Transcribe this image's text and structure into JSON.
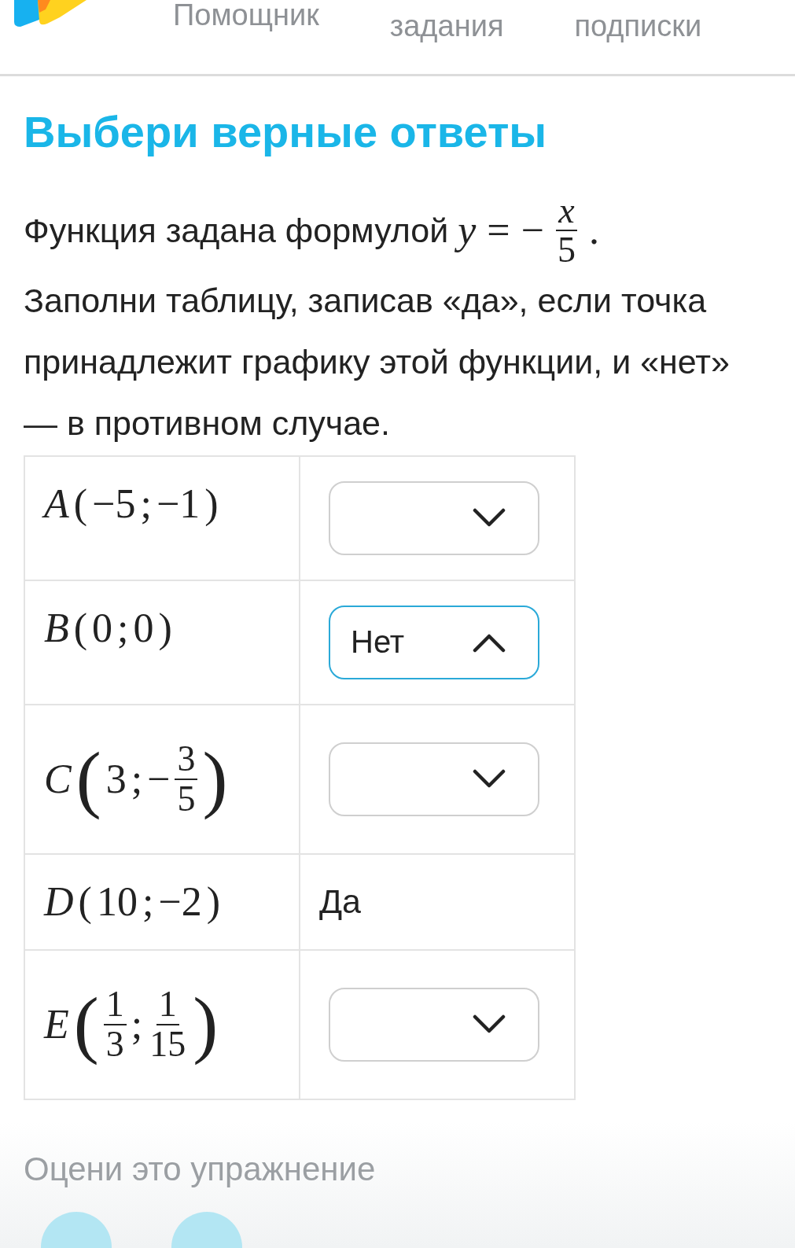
{
  "header": {
    "nav": [
      {
        "label": "Помощник",
        "selected": false
      },
      {
        "label": "задания",
        "selected": false
      },
      {
        "label": "подписки",
        "selected": false
      }
    ]
  },
  "title": "Выбери верные ответы",
  "statement": {
    "text": "Функция задана формулой",
    "formula": {
      "lhs": "y",
      "sign": "=",
      "minus": "−",
      "numerator": "x",
      "denominator": "5",
      "end": "."
    }
  },
  "instruction": "Заполни таблицу, записав «да», если точка принадлежит графику этой функции, и «нет» — в противном случае.",
  "rows": [
    {
      "point": "A",
      "open": "(",
      "sep": ";",
      "close": ")",
      "coords": [
        {
          "kind": "plain",
          "text": "−5"
        },
        {
          "kind": "plain",
          "text": "−1"
        }
      ],
      "answer": {
        "kind": "dropdown",
        "expanded": false
      }
    },
    {
      "point": "B",
      "open": "(",
      "sep": ";",
      "close": ")",
      "coords": [
        {
          "kind": "plain",
          "text": "0"
        },
        {
          "kind": "plain",
          "text": "0"
        }
      ],
      "answer": {
        "kind": "dropdown",
        "value": "Нет",
        "expanded": true
      }
    },
    {
      "point": "C",
      "open": "(",
      "sep": ";",
      "close": ")",
      "coords": [
        {
          "kind": "plain",
          "text": "3"
        },
        {
          "kind": "fraction",
          "sign": "−",
          "num": "3",
          "den": "5"
        }
      ],
      "answer": {
        "kind": "dropdown",
        "expanded": false
      }
    },
    {
      "point": "D",
      "open": "(",
      "sep": ";",
      "close": ")",
      "coords": [
        {
          "kind": "plain",
          "text": "10"
        },
        {
          "kind": "plain",
          "text": "−2"
        }
      ],
      "answer": {
        "kind": "text",
        "value": "Да"
      }
    },
    {
      "point": "E",
      "open": "(",
      "sep": ";",
      "close": ")",
      "coords": [
        {
          "kind": "fraction",
          "num": "1",
          "den": "3"
        },
        {
          "kind": "fraction",
          "num": "1",
          "den": "15"
        }
      ],
      "answer": {
        "kind": "dropdown",
        "expanded": false
      }
    }
  ],
  "rating": {
    "label": "Оцени это упражнение"
  }
}
